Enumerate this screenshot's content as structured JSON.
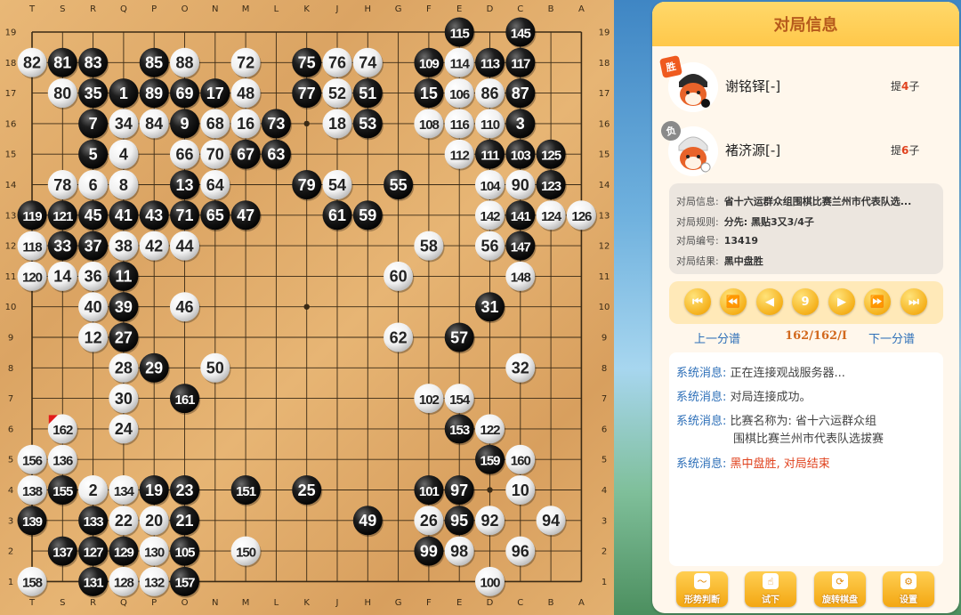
{
  "board": {
    "columns": [
      "T",
      "S",
      "R",
      "Q",
      "P",
      "O",
      "N",
      "M",
      "L",
      "K",
      "J",
      "H",
      "G",
      "F",
      "E",
      "D",
      "C",
      "B",
      "A"
    ],
    "rows": [
      19,
      18,
      17,
      16,
      15,
      14,
      13,
      12,
      11,
      10,
      9,
      8,
      7,
      6,
      5,
      4,
      3,
      2,
      1
    ],
    "stones": [
      {
        "c": "E19",
        "n": 115,
        "b": 1
      },
      {
        "c": "C19",
        "n": 145,
        "b": 1
      },
      {
        "c": "T18",
        "n": 82,
        "b": 0
      },
      {
        "c": "S18",
        "n": 81,
        "b": 1
      },
      {
        "c": "R18",
        "n": 83,
        "b": 1
      },
      {
        "c": "P18",
        "n": 85,
        "b": 1
      },
      {
        "c": "O18",
        "n": 88,
        "b": 0
      },
      {
        "c": "M18",
        "n": 72,
        "b": 0
      },
      {
        "c": "K18",
        "n": 75,
        "b": 1
      },
      {
        "c": "J18",
        "n": 76,
        "b": 0
      },
      {
        "c": "H18",
        "n": 74,
        "b": 0
      },
      {
        "c": "F18",
        "n": 109,
        "b": 1
      },
      {
        "c": "E18",
        "n": 114,
        "b": 0
      },
      {
        "c": "D18",
        "n": 113,
        "b": 1
      },
      {
        "c": "C18",
        "n": 117,
        "b": 1
      },
      {
        "c": "S17",
        "n": 80,
        "b": 0
      },
      {
        "c": "R17",
        "n": 35,
        "b": 1
      },
      {
        "c": "Q17",
        "n": 1,
        "b": 1
      },
      {
        "c": "P17",
        "n": 89,
        "b": 1
      },
      {
        "c": "O17",
        "n": 69,
        "b": 1
      },
      {
        "c": "N17",
        "n": 17,
        "b": 1
      },
      {
        "c": "M17",
        "n": 48,
        "b": 0
      },
      {
        "c": "K17",
        "n": 77,
        "b": 1
      },
      {
        "c": "J17",
        "n": 52,
        "b": 0
      },
      {
        "c": "H17",
        "n": 51,
        "b": 1
      },
      {
        "c": "F17",
        "n": 15,
        "b": 1
      },
      {
        "c": "E17",
        "n": 106,
        "b": 0
      },
      {
        "c": "D17",
        "n": 86,
        "b": 0
      },
      {
        "c": "C17",
        "n": 87,
        "b": 1
      },
      {
        "c": "R16",
        "n": 7,
        "b": 1
      },
      {
        "c": "Q16",
        "n": 34,
        "b": 0
      },
      {
        "c": "P16",
        "n": 84,
        "b": 0
      },
      {
        "c": "O16",
        "n": 9,
        "b": 1
      },
      {
        "c": "N16",
        "n": 68,
        "b": 0
      },
      {
        "c": "M16",
        "n": 16,
        "b": 0
      },
      {
        "c": "L16",
        "n": 73,
        "b": 1
      },
      {
        "c": "J16",
        "n": 18,
        "b": 0
      },
      {
        "c": "H16",
        "n": 53,
        "b": 1
      },
      {
        "c": "F16",
        "n": 108,
        "b": 0
      },
      {
        "c": "E16",
        "n": 116,
        "b": 0
      },
      {
        "c": "D16",
        "n": 110,
        "b": 0
      },
      {
        "c": "C16",
        "n": 3,
        "b": 1
      },
      {
        "c": "R15",
        "n": 5,
        "b": 1
      },
      {
        "c": "Q15",
        "n": 4,
        "b": 0
      },
      {
        "c": "O15",
        "n": 66,
        "b": 0
      },
      {
        "c": "N15",
        "n": 70,
        "b": 0
      },
      {
        "c": "M15",
        "n": 67,
        "b": 1
      },
      {
        "c": "L15",
        "n": 63,
        "b": 1
      },
      {
        "c": "E15",
        "n": 112,
        "b": 0
      },
      {
        "c": "D15",
        "n": 111,
        "b": 1
      },
      {
        "c": "C15",
        "n": 103,
        "b": 1
      },
      {
        "c": "B15",
        "n": 125,
        "b": 1
      },
      {
        "c": "S14",
        "n": 78,
        "b": 0
      },
      {
        "c": "R14",
        "n": 6,
        "b": 0
      },
      {
        "c": "Q14",
        "n": 8,
        "b": 0
      },
      {
        "c": "O14",
        "n": 13,
        "b": 1
      },
      {
        "c": "N14",
        "n": 64,
        "b": 0
      },
      {
        "c": "K14",
        "n": 79,
        "b": 1
      },
      {
        "c": "J14",
        "n": 54,
        "b": 0
      },
      {
        "c": "G14",
        "n": 55,
        "b": 1
      },
      {
        "c": "D14",
        "n": 104,
        "b": 0
      },
      {
        "c": "C14",
        "n": 90,
        "b": 0
      },
      {
        "c": "B14",
        "n": 123,
        "b": 1
      },
      {
        "c": "T13",
        "n": 119,
        "b": 1
      },
      {
        "c": "S13",
        "n": 121,
        "b": 1
      },
      {
        "c": "R13",
        "n": 45,
        "b": 1
      },
      {
        "c": "Q13",
        "n": 41,
        "b": 1
      },
      {
        "c": "P13",
        "n": 43,
        "b": 1
      },
      {
        "c": "O13",
        "n": 71,
        "b": 1
      },
      {
        "c": "N13",
        "n": 65,
        "b": 1
      },
      {
        "c": "M13",
        "n": 47,
        "b": 1
      },
      {
        "c": "J13",
        "n": 61,
        "b": 1
      },
      {
        "c": "H13",
        "n": 59,
        "b": 1
      },
      {
        "c": "D13",
        "n": 142,
        "b": 0
      },
      {
        "c": "C13",
        "n": 141,
        "b": 1
      },
      {
        "c": "B13",
        "n": 124,
        "b": 0
      },
      {
        "c": "A13",
        "n": 126,
        "b": 0
      },
      {
        "c": "T12",
        "n": 118,
        "b": 0
      },
      {
        "c": "S12",
        "n": 33,
        "b": 1
      },
      {
        "c": "R12",
        "n": 37,
        "b": 1
      },
      {
        "c": "Q12",
        "n": 38,
        "b": 0
      },
      {
        "c": "P12",
        "n": 42,
        "b": 0
      },
      {
        "c": "O12",
        "n": 44,
        "b": 0
      },
      {
        "c": "F12",
        "n": 58,
        "b": 0
      },
      {
        "c": "D12",
        "n": 56,
        "b": 0
      },
      {
        "c": "C12",
        "n": 147,
        "b": 1
      },
      {
        "c": "T11",
        "n": 120,
        "b": 0
      },
      {
        "c": "S11",
        "n": 14,
        "b": 0
      },
      {
        "c": "R11",
        "n": 36,
        "b": 0
      },
      {
        "c": "Q11",
        "n": 11,
        "b": 1
      },
      {
        "c": "G11",
        "n": 60,
        "b": 0
      },
      {
        "c": "C11",
        "n": 148,
        "b": 0
      },
      {
        "c": "R10",
        "n": 40,
        "b": 0
      },
      {
        "c": "Q10",
        "n": 39,
        "b": 1
      },
      {
        "c": "O10",
        "n": 46,
        "b": 0
      },
      {
        "c": "D10",
        "n": 31,
        "b": 1
      },
      {
        "c": "R9",
        "n": 12,
        "b": 0
      },
      {
        "c": "Q9",
        "n": 27,
        "b": 1
      },
      {
        "c": "G9",
        "n": 62,
        "b": 0
      },
      {
        "c": "E9",
        "n": 57,
        "b": 1
      },
      {
        "c": "Q8",
        "n": 28,
        "b": 0
      },
      {
        "c": "P8",
        "n": 29,
        "b": 1
      },
      {
        "c": "N8",
        "n": 50,
        "b": 0
      },
      {
        "c": "C8",
        "n": 32,
        "b": 0
      },
      {
        "c": "Q7",
        "n": 30,
        "b": 0
      },
      {
        "c": "O7",
        "n": 161,
        "b": 1
      },
      {
        "c": "F7",
        "n": 102,
        "b": 0
      },
      {
        "c": "E7",
        "n": 154,
        "b": 0
      },
      {
        "c": "S6",
        "n": 162,
        "b": 0,
        "last": 1
      },
      {
        "c": "Q6",
        "n": 24,
        "b": 0
      },
      {
        "c": "E6",
        "n": 153,
        "b": 1
      },
      {
        "c": "D6",
        "n": 122,
        "b": 0
      },
      {
        "c": "T5",
        "n": 156,
        "b": 0
      },
      {
        "c": "S5",
        "n": 136,
        "b": 0
      },
      {
        "c": "D5",
        "n": 159,
        "b": 1
      },
      {
        "c": "C5",
        "n": 160,
        "b": 0
      },
      {
        "c": "T4",
        "n": 138,
        "b": 0
      },
      {
        "c": "S4",
        "n": 155,
        "b": 1
      },
      {
        "c": "R4",
        "n": 2,
        "b": 0
      },
      {
        "c": "Q4",
        "n": 134,
        "b": 0
      },
      {
        "c": "P4",
        "n": 19,
        "b": 1
      },
      {
        "c": "O4",
        "n": 23,
        "b": 1
      },
      {
        "c": "M4",
        "n": 151,
        "b": 1
      },
      {
        "c": "K4",
        "n": 25,
        "b": 1
      },
      {
        "c": "F4",
        "n": 101,
        "b": 1
      },
      {
        "c": "E4",
        "n": 97,
        "b": 1
      },
      {
        "c": "C4",
        "n": 10,
        "b": 0
      },
      {
        "c": "T3",
        "n": 139,
        "b": 1
      },
      {
        "c": "R3",
        "n": 133,
        "b": 1
      },
      {
        "c": "Q3",
        "n": 22,
        "b": 0
      },
      {
        "c": "P3",
        "n": 20,
        "b": 0
      },
      {
        "c": "O3",
        "n": 21,
        "b": 1
      },
      {
        "c": "H3",
        "n": 49,
        "b": 1
      },
      {
        "c": "F3",
        "n": 26,
        "b": 0
      },
      {
        "c": "E3",
        "n": 95,
        "b": 1
      },
      {
        "c": "D3",
        "n": 92,
        "b": 0
      },
      {
        "c": "B3",
        "n": 94,
        "b": 0
      },
      {
        "c": "S2",
        "n": 137,
        "b": 1
      },
      {
        "c": "R2",
        "n": 127,
        "b": 1
      },
      {
        "c": "Q2",
        "n": 129,
        "b": 1
      },
      {
        "c": "P2",
        "n": 130,
        "b": 0
      },
      {
        "c": "O2",
        "n": 105,
        "b": 1
      },
      {
        "c": "M2",
        "n": 150,
        "b": 0
      },
      {
        "c": "F2",
        "n": 99,
        "b": 1
      },
      {
        "c": "E2",
        "n": 98,
        "b": 0
      },
      {
        "c": "C2",
        "n": 96,
        "b": 0
      },
      {
        "c": "T1",
        "n": 158,
        "b": 0
      },
      {
        "c": "R1",
        "n": 131,
        "b": 1
      },
      {
        "c": "Q1",
        "n": 128,
        "b": 0
      },
      {
        "c": "P1",
        "n": 132,
        "b": 0
      },
      {
        "c": "O1",
        "n": 157,
        "b": 1
      },
      {
        "c": "D1",
        "n": 100,
        "b": 0
      }
    ],
    "hoshi": [
      "Q16",
      "K16",
      "D16",
      "Q10",
      "K10",
      "D10",
      "Q4",
      "K4",
      "D4"
    ]
  },
  "panel": {
    "title": "对局信息",
    "player1": {
      "badge": "胜",
      "name": "谢铭铎[-]",
      "captures_prefix": "提",
      "captures": "4",
      "captures_suffix": "子"
    },
    "player2": {
      "badge": "负",
      "name": "褚济源[-]",
      "captures_prefix": "提",
      "captures": "6",
      "captures_suffix": "子"
    },
    "info": [
      {
        "label": "对局信息:",
        "value": "省十六运群众组围棋比赛兰州市代表队选..."
      },
      {
        "label": "对局规则:",
        "value": "分先:  黑贴3又3/4子"
      },
      {
        "label": "对局编号:",
        "value": "13419"
      },
      {
        "label": "对局结果:",
        "value": "黑中盘胜"
      }
    ],
    "nav": {
      "buttons": [
        "first",
        "prev10",
        "prev",
        "jump",
        "next",
        "next10",
        "last"
      ],
      "jump_label": "9"
    },
    "move_row": {
      "prev_variation": "上一分谱",
      "counter": "162/162/I",
      "next_variation": "下一分谱"
    },
    "messages": [
      {
        "label": "系统消息:",
        "text": "正在连接观战服务器...",
        "red": false
      },
      {
        "label": "系统消息:",
        "text": "对局连接成功。",
        "red": false
      },
      {
        "label": "系统消息:",
        "text": "比赛名称为: 省十六运群众组",
        "text2": "围棋比赛兰州市代表队选拔赛",
        "red": false
      },
      {
        "label": "系统消息:",
        "text": "黑中盘胜, 对局结束",
        "red": true
      }
    ],
    "tools": [
      "形势判断",
      "试下",
      "旋转棋盘",
      "设置"
    ]
  },
  "colors": {
    "accent": "#f3a712",
    "win": "#ef5a1f",
    "link": "#2d6fb8",
    "red": "#e0421e"
  }
}
